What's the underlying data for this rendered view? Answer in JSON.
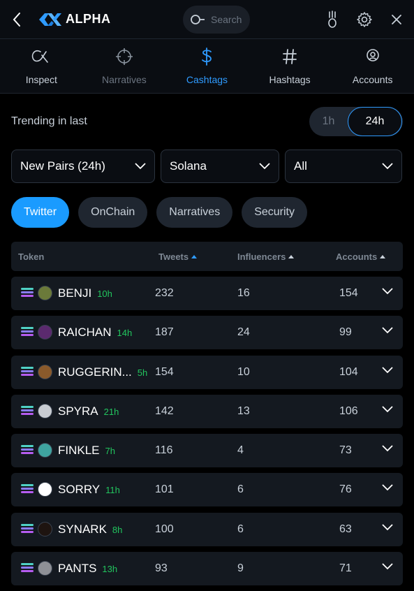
{
  "header": {
    "brand": "ALPHA",
    "search_placeholder": "Search"
  },
  "tabs": [
    {
      "label": "Inspect",
      "icon": "alpha-logo-icon"
    },
    {
      "label": "Narratives",
      "icon": "crosshair-icon"
    },
    {
      "label": "Cashtags",
      "icon": "dollar-icon"
    },
    {
      "label": "Hashtags",
      "icon": "hash-icon"
    },
    {
      "label": "Accounts",
      "icon": "account-icon"
    }
  ],
  "trending": {
    "label": "Trending in last",
    "options": [
      "1h",
      "24h"
    ],
    "selected": "24h"
  },
  "filters": {
    "pair_type": "New Pairs (24h)",
    "chain": "Solana",
    "scope": "All"
  },
  "pills": [
    "Twitter",
    "OnChain",
    "Narratives",
    "Security"
  ],
  "table": {
    "headers": {
      "token": "Token",
      "tweets": "Tweets",
      "influencers": "Influencers",
      "accounts": "Accounts"
    },
    "rows": [
      {
        "token": "BENJI",
        "age": "10h",
        "tweets": "232",
        "influencers": "16",
        "accounts": "154"
      },
      {
        "token": "RAICHAN",
        "age": "14h",
        "tweets": "187",
        "influencers": "24",
        "accounts": "99"
      },
      {
        "token": "RUGGERIN...",
        "age": "5h",
        "tweets": "154",
        "influencers": "10",
        "accounts": "104"
      },
      {
        "token": "SPYRA",
        "age": "21h",
        "tweets": "142",
        "influencers": "13",
        "accounts": "106"
      },
      {
        "token": "FINKLE",
        "age": "7h",
        "tweets": "116",
        "influencers": "4",
        "accounts": "73"
      },
      {
        "token": "SORRY",
        "age": "11h",
        "tweets": "101",
        "influencers": "6",
        "accounts": "76"
      },
      {
        "token": "SYNARK",
        "age": "8h",
        "tweets": "100",
        "influencers": "6",
        "accounts": "63"
      },
      {
        "token": "PANTS",
        "age": "13h",
        "tweets": "93",
        "influencers": "9",
        "accounts": "71"
      }
    ]
  },
  "colors": {
    "accent": "#2f9bff",
    "age_green": "#22c55e",
    "background": "#000000"
  }
}
